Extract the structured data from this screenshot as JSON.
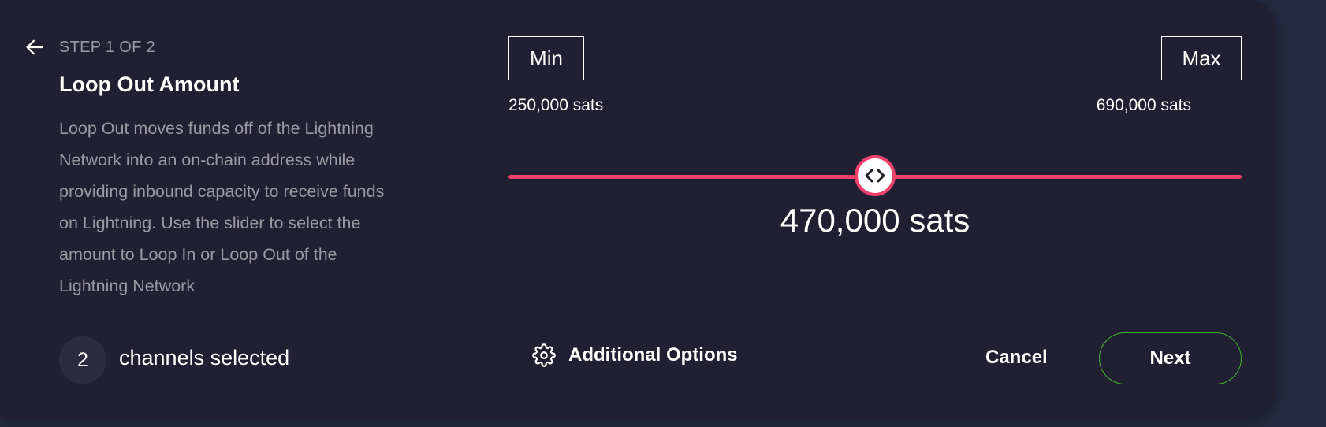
{
  "header": {
    "step_label": "STEP 1 OF 2",
    "title": "Loop Out Amount",
    "description": "Loop Out moves funds off of the Lightning Network into an on-chain address while providing inbound capacity to receive funds on Lightning. Use the slider to select the amount to Loop In or Loop Out of the Lightning Network"
  },
  "channels": {
    "count": "2",
    "label": "channels selected"
  },
  "amount": {
    "min_label": "Min",
    "max_label": "Max",
    "min_value": "250,000 sats",
    "max_value": "690,000 sats",
    "current_value": "470,000 sats",
    "slider_fraction": 0.5
  },
  "footer": {
    "options_label": "Additional Options",
    "cancel_label": "Cancel",
    "next_label": "Next"
  },
  "colors": {
    "background": "#242a41",
    "panel": "#212032",
    "accent_slider": "#f0416c",
    "next_border": "#3fb42d",
    "muted_text": "#9a9aa4"
  },
  "icons": {
    "back": "arrow-left-icon",
    "handle": "chevrons-left-right-icon",
    "options": "gear-icon"
  }
}
